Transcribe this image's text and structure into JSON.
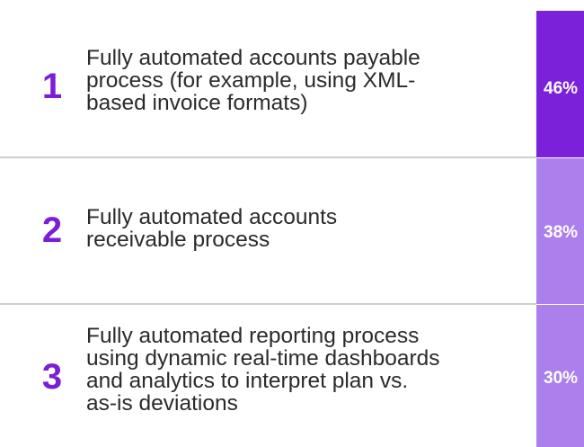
{
  "chart_data": {
    "type": "bar",
    "categories": [
      "Fully automated accounts payable process (for example, using XML-based invoice formats)",
      "Fully automated accounts receivable process",
      "Fully automated reporting process using dynamic real-time dashboards and analytics to interpret plan vs. as-is deviations"
    ],
    "ranks": [
      "1",
      "2",
      "3"
    ],
    "label_lines": [
      [
        "Fully automated accounts payable",
        "process (for example, using XML-",
        "based invoice formats)"
      ],
      [
        "Fully automated accounts",
        "receivable process"
      ],
      [
        "Fully automated reporting process",
        "using dynamic real-time dashboards",
        "and analytics to interpret plan vs.",
        "as-is deviations"
      ]
    ],
    "values": [
      46,
      38,
      30
    ],
    "value_labels": [
      "46%",
      "38%",
      "30%"
    ],
    "unit": "%",
    "colors": [
      "#7b21d9",
      "#ab80ec",
      "#ab80ec"
    ]
  }
}
